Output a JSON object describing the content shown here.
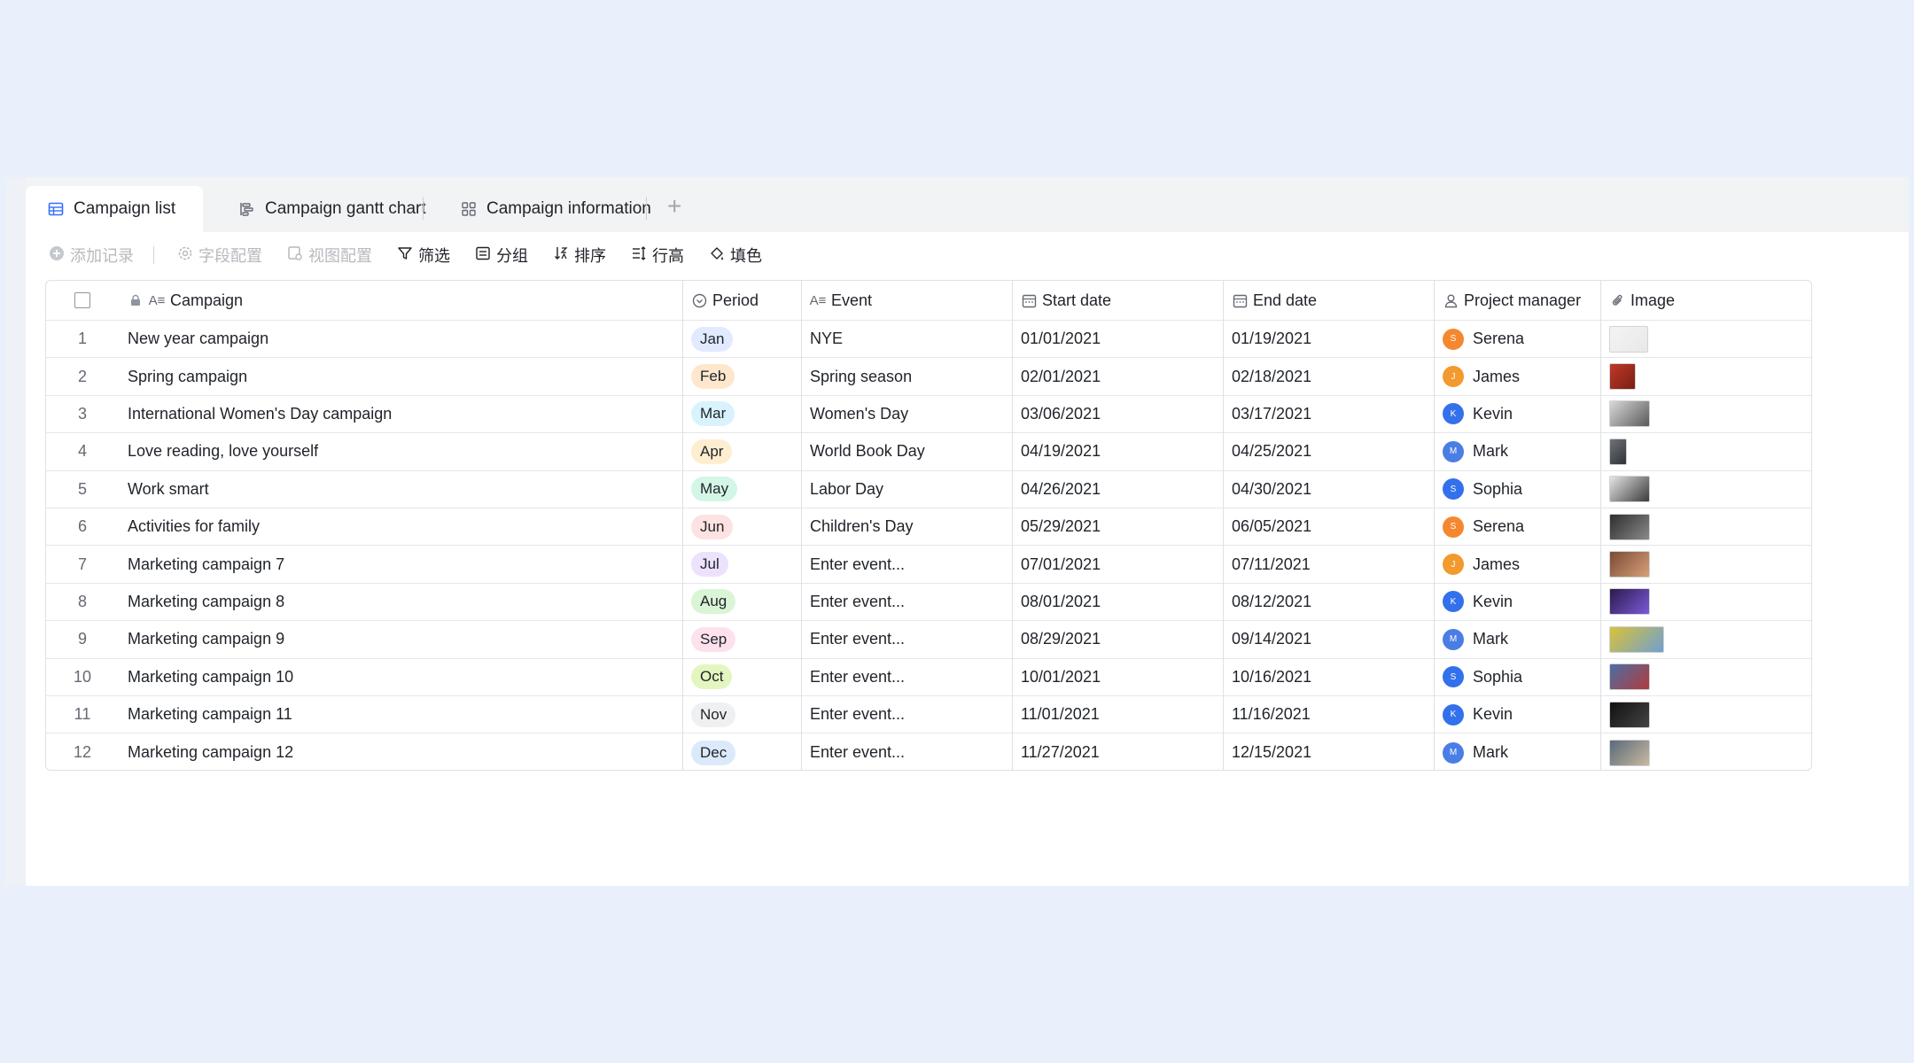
{
  "tabs": [
    {
      "label": "Campaign list",
      "icon": "table-icon",
      "active": true
    },
    {
      "label": "Campaign gantt chart",
      "icon": "gantt-icon",
      "active": false
    },
    {
      "label": "Campaign information",
      "icon": "grid-icon",
      "active": false
    }
  ],
  "toolbar": {
    "add_record": "添加记录",
    "field_config": "字段配置",
    "view_config": "视图配置",
    "filter": "筛选",
    "group": "分组",
    "sort": "排序",
    "row_height": "行高",
    "fill_color": "填色"
  },
  "columns": {
    "campaign": "Campaign",
    "period": "Period",
    "event": "Event",
    "start_date": "Start date",
    "end_date": "End date",
    "project_manager": "Project manager",
    "image": "Image"
  },
  "period_colors": {
    "Jan": "#e1eaff",
    "Feb": "#fee7cd",
    "Mar": "#d9f3fd",
    "Apr": "#feeed0",
    "May": "#d4f6e6",
    "Jun": "#fde2e2",
    "Jul": "#ece2fe",
    "Aug": "#d9f5d6",
    "Sep": "#fde2ed",
    "Oct": "#e4f6c0",
    "Nov": "#eff0f1",
    "Dec": "#dce9fb"
  },
  "manager_colors": {
    "Serena": "#f5882f",
    "James": "#f29a2e",
    "Kevin": "#3370eb",
    "Mark": "#4a7ee5",
    "Sophia": "#3370eb"
  },
  "rows": [
    {
      "num": "1",
      "campaign": "New year campaign",
      "period": "Jan",
      "event": "NYE",
      "start": "01/01/2021",
      "end": "01/19/2021",
      "manager": "Serena",
      "initial": "S",
      "img": [
        "#f4f4f4",
        "#e8e8e8"
      ]
    },
    {
      "num": "2",
      "campaign": "Spring campaign",
      "period": "Feb",
      "event": "Spring season",
      "start": "02/01/2021",
      "end": "02/18/2021",
      "manager": "James",
      "initial": "J",
      "img": [
        "#c0392b",
        "#7b1d12"
      ]
    },
    {
      "num": "3",
      "campaign": "International Women's Day campaign",
      "period": "Mar",
      "event": "Women's Day",
      "start": "03/06/2021",
      "end": "03/17/2021",
      "manager": "Kevin",
      "initial": "K",
      "img": [
        "#d9d9d9",
        "#5a5a5a"
      ]
    },
    {
      "num": "4",
      "campaign": "Love reading, love yourself",
      "period": "Apr",
      "event": "World Book Day",
      "start": "04/19/2021",
      "end": "04/25/2021",
      "manager": "Mark",
      "initial": "M",
      "img": [
        "#6f7378",
        "#2f3338"
      ]
    },
    {
      "num": "5",
      "campaign": "Work smart",
      "period": "May",
      "event": "Labor Day",
      "start": "04/26/2021",
      "end": "04/30/2021",
      "manager": "Sophia",
      "initial": "S",
      "img": [
        "#e6e6e6",
        "#3a3a3a"
      ]
    },
    {
      "num": "6",
      "campaign": "Activities for family",
      "period": "Jun",
      "event": "Children's Day",
      "start": "05/29/2021",
      "end": "06/05/2021",
      "manager": "Serena",
      "initial": "S",
      "img": [
        "#2e2e2e",
        "#8a8a8a"
      ]
    },
    {
      "num": "7",
      "campaign": "Marketing campaign 7",
      "period": "Jul",
      "event": "Enter event...",
      "start": "07/01/2021",
      "end": "07/11/2021",
      "manager": "James",
      "initial": "J",
      "img": [
        "#7a4a35",
        "#d9a07a"
      ]
    },
    {
      "num": "8",
      "campaign": "Marketing campaign 8",
      "period": "Aug",
      "event": "Enter event...",
      "start": "08/01/2021",
      "end": "08/12/2021",
      "manager": "Kevin",
      "initial": "K",
      "img": [
        "#2b1b4a",
        "#7a5ad9"
      ]
    },
    {
      "num": "9",
      "campaign": "Marketing campaign 9",
      "period": "Sep",
      "event": "Enter event...",
      "start": "08/29/2021",
      "end": "09/14/2021",
      "manager": "Mark",
      "initial": "M",
      "img": [
        "#d9c23a",
        "#6fa0d0"
      ]
    },
    {
      "num": "10",
      "campaign": "Marketing campaign 10",
      "period": "Oct",
      "event": "Enter event...",
      "start": "10/01/2021",
      "end": "10/16/2021",
      "manager": "Sophia",
      "initial": "S",
      "img": [
        "#4a6fa5",
        "#b33a3a"
      ]
    },
    {
      "num": "11",
      "campaign": "Marketing campaign 11",
      "period": "Nov",
      "event": "Enter event...",
      "start": "11/01/2021",
      "end": "11/16/2021",
      "manager": "Kevin",
      "initial": "K",
      "img": [
        "#111111",
        "#444444"
      ]
    },
    {
      "num": "12",
      "campaign": "Marketing campaign 12",
      "period": "Dec",
      "event": "Enter event...",
      "start": "11/27/2021",
      "end": "12/15/2021",
      "manager": "Mark",
      "initial": "M",
      "img": [
        "#5a6a7a",
        "#c9b9a0"
      ]
    }
  ]
}
